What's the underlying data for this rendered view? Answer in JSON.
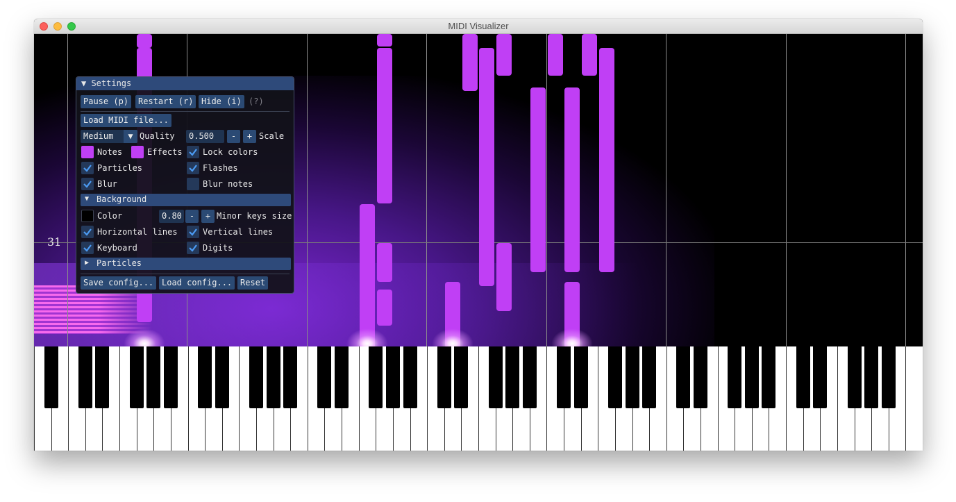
{
  "window": {
    "title": "MIDI Visualizer"
  },
  "colors": {
    "note": "#c03ff5",
    "accent": "#2b4a74",
    "background": "#000000"
  },
  "stage": {
    "digit": "31"
  },
  "settings": {
    "title": "Settings",
    "collapse_icon": "triangle-down-icon",
    "pause_label": "Pause (p)",
    "restart_label": "Restart (r)",
    "hide_label": "Hide (i)",
    "help_label": "(?)",
    "load_midi_label": "Load MIDI file...",
    "quality_value": "Medium",
    "quality_label": "Quality",
    "scale_value": "0.500",
    "scale_label": "Scale",
    "minus_label": "-",
    "plus_label": "+",
    "notes_label": "Notes",
    "notes_color": "#c03ff5",
    "effects_label": "Effects",
    "effects_color": "#c03ff5",
    "lock_colors_label": "Lock colors",
    "lock_colors_checked": true,
    "particles_label": "Particles",
    "particles_checked": true,
    "flashes_label": "Flashes",
    "flashes_checked": true,
    "blur_label": "Blur",
    "blur_checked": true,
    "blur_notes_label": "Blur notes",
    "blur_notes_checked": false,
    "background_section": "Background",
    "bg_color_label": "Color",
    "bg_color": "#000000",
    "minor_keys_value": "0.80",
    "minor_keys_label": "Minor keys size",
    "horizontal_lines_label": "Horizontal lines",
    "horizontal_lines_checked": true,
    "vertical_lines_label": "Vertical lines",
    "vertical_lines_checked": true,
    "keyboard_label": "Keyboard",
    "keyboard_checked": true,
    "digits_label": "Digits",
    "digits_checked": true,
    "particles_section": "Particles",
    "save_config_label": "Save config...",
    "load_config_label": "Load config...",
    "reset_label": "Reset"
  }
}
